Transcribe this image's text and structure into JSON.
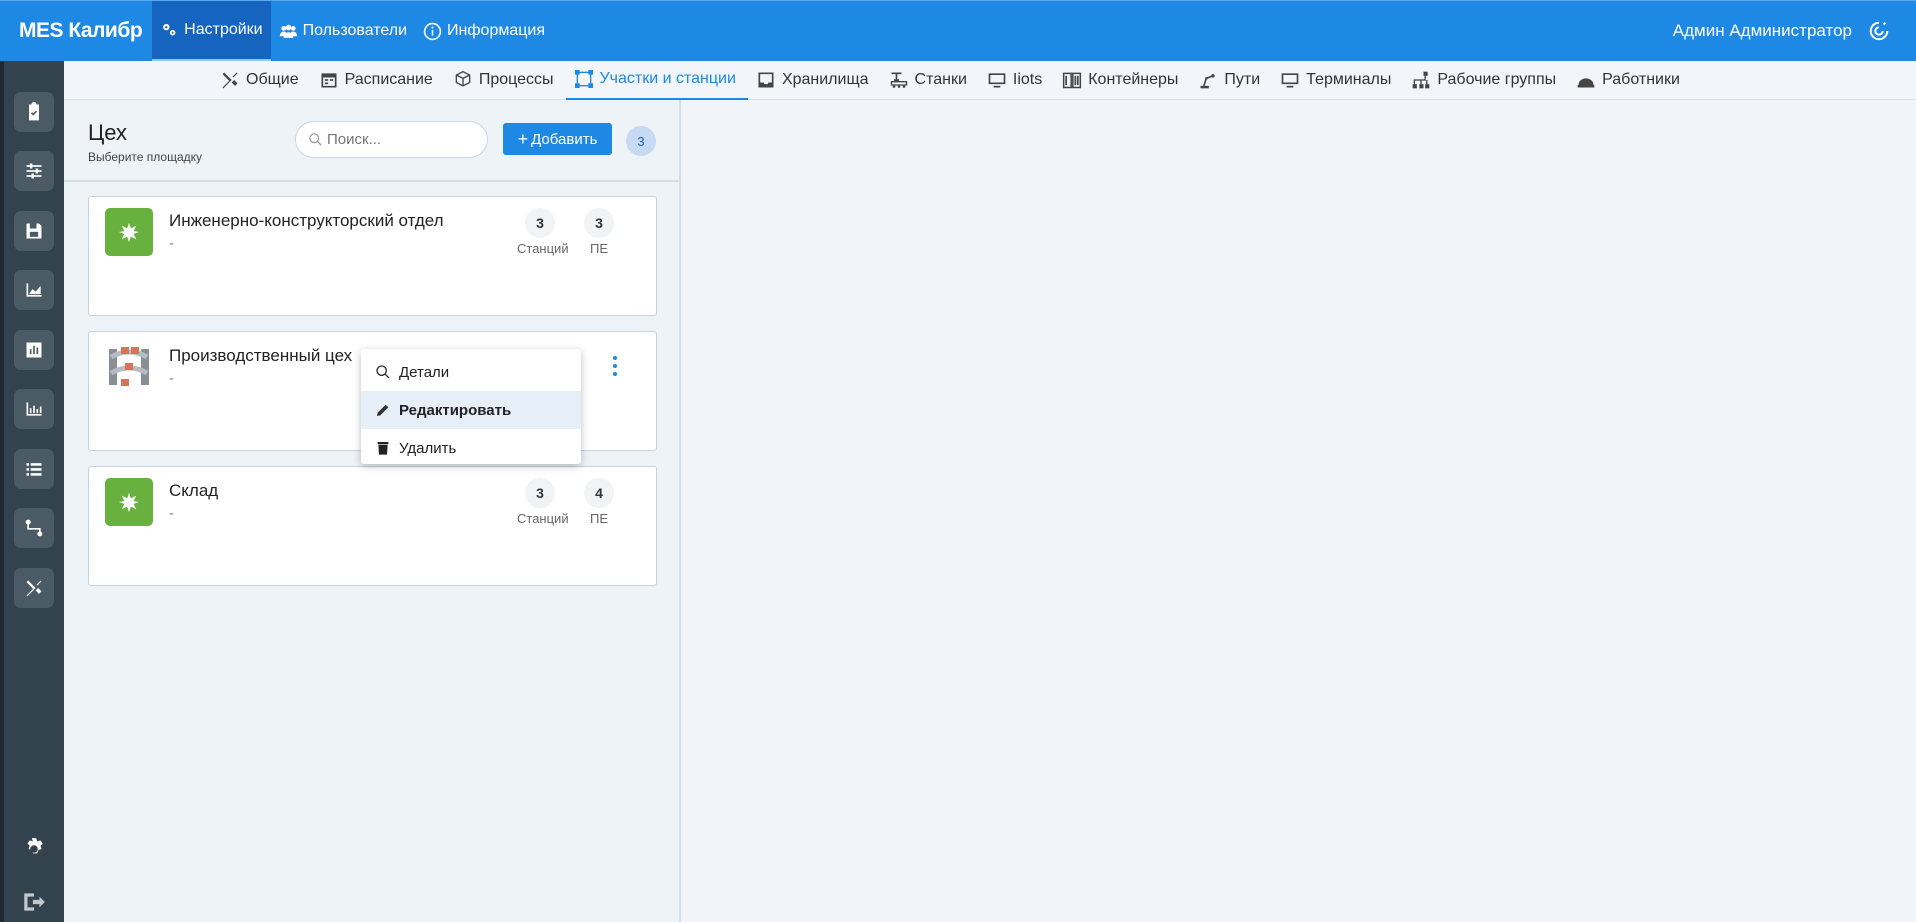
{
  "app": {
    "brand": "MES Калибр",
    "user": "Админ Администратор"
  },
  "topnav": [
    {
      "label": "Настройки",
      "icon": "gears-icon",
      "active": true
    },
    {
      "label": "Пользователи",
      "icon": "users-icon"
    },
    {
      "label": "Информация",
      "icon": "info-icon"
    }
  ],
  "subnav": [
    {
      "label": "Общие",
      "icon": "tools-icon"
    },
    {
      "label": "Расписание",
      "icon": "calendar-icon"
    },
    {
      "label": "Процессы",
      "icon": "cubes-icon"
    },
    {
      "label": "Участки и станции",
      "icon": "vector-square-icon",
      "active": true
    },
    {
      "label": "Хранилища",
      "icon": "inbox-icon"
    },
    {
      "label": "Станки",
      "icon": "machine-icon"
    },
    {
      "label": "Iiots",
      "icon": "monitor-icon"
    },
    {
      "label": "Контейнеры",
      "icon": "container-icon"
    },
    {
      "label": "Пути",
      "icon": "route-icon"
    },
    {
      "label": "Терминалы",
      "icon": "terminal-icon"
    },
    {
      "label": "Рабочие группы",
      "icon": "sitemap-icon"
    },
    {
      "label": "Работники",
      "icon": "hard-hat-icon"
    }
  ],
  "panel": {
    "title": "Цех",
    "subtitle": "Выберите площадку",
    "search_placeholder": "Поиск...",
    "add_label": "Добавить",
    "count": "3"
  },
  "cards": [
    {
      "title": "Инженерно-конструкторский отдел",
      "desc": "-",
      "stations": "3",
      "stations_label": "Станций",
      "pe": "3",
      "pe_label": "ПЕ"
    },
    {
      "title": "Производственный цех",
      "desc": "-"
    },
    {
      "title": "Склад",
      "desc": "-",
      "stations": "3",
      "stations_label": "Станций",
      "pe": "4",
      "pe_label": "ПЕ"
    }
  ],
  "context_menu": [
    {
      "label": "Детали",
      "icon": "search-icon"
    },
    {
      "label": "Редактировать",
      "icon": "pencil-icon",
      "highlighted": true
    },
    {
      "label": "Удалить",
      "icon": "trash-icon"
    }
  ],
  "colors": {
    "primary": "#1e88e5",
    "sidebar": "#33434d",
    "card_icon": "#68b13e"
  }
}
